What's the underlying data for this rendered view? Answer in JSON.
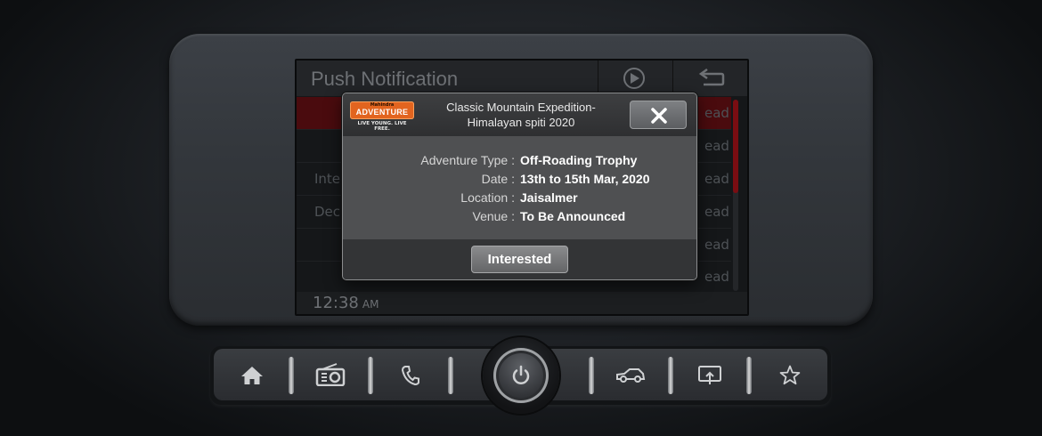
{
  "screen": {
    "title": "Push Notification",
    "rows": [
      {
        "lead": "",
        "tail": "ead"
      },
      {
        "lead": "",
        "tail": "ead"
      },
      {
        "lead": "Inte",
        "tail": "ead"
      },
      {
        "lead": "Dec",
        "tail": "ead"
      },
      {
        "lead": "",
        "tail": "ead"
      },
      {
        "lead": "",
        "tail": "ead"
      }
    ],
    "clock": "12:38",
    "ampm": "AM"
  },
  "dialog": {
    "logo": {
      "small": "Mahindra",
      "big": "ADVENTURE",
      "tag": "LIVE YOUNG. LIVE FREE."
    },
    "title_line1": "Classic Mountain Expedition-",
    "title_line2": "Himalayan spiti 2020",
    "details": [
      {
        "label": "Adventure Type :",
        "value": "Off-Roading Trophy"
      },
      {
        "label": "Date :",
        "value": "13th to 15th Mar, 2020"
      },
      {
        "label": "Location :",
        "value": "Jaisalmer"
      },
      {
        "label": "Venue :",
        "value": "To Be Announced"
      }
    ],
    "action_label": "Interested"
  },
  "icons": {
    "play": "play-icon",
    "back": "back-arrow-icon",
    "close": "close-icon",
    "home": "home-icon",
    "radio": "radio-icon",
    "phone": "phone-icon",
    "power": "power-icon",
    "car": "car-icon",
    "projection": "screen-projection-icon",
    "favorite": "star-icon"
  },
  "colors": {
    "accent_red": "#7a0d12",
    "logo_orange": "#e2641f"
  }
}
